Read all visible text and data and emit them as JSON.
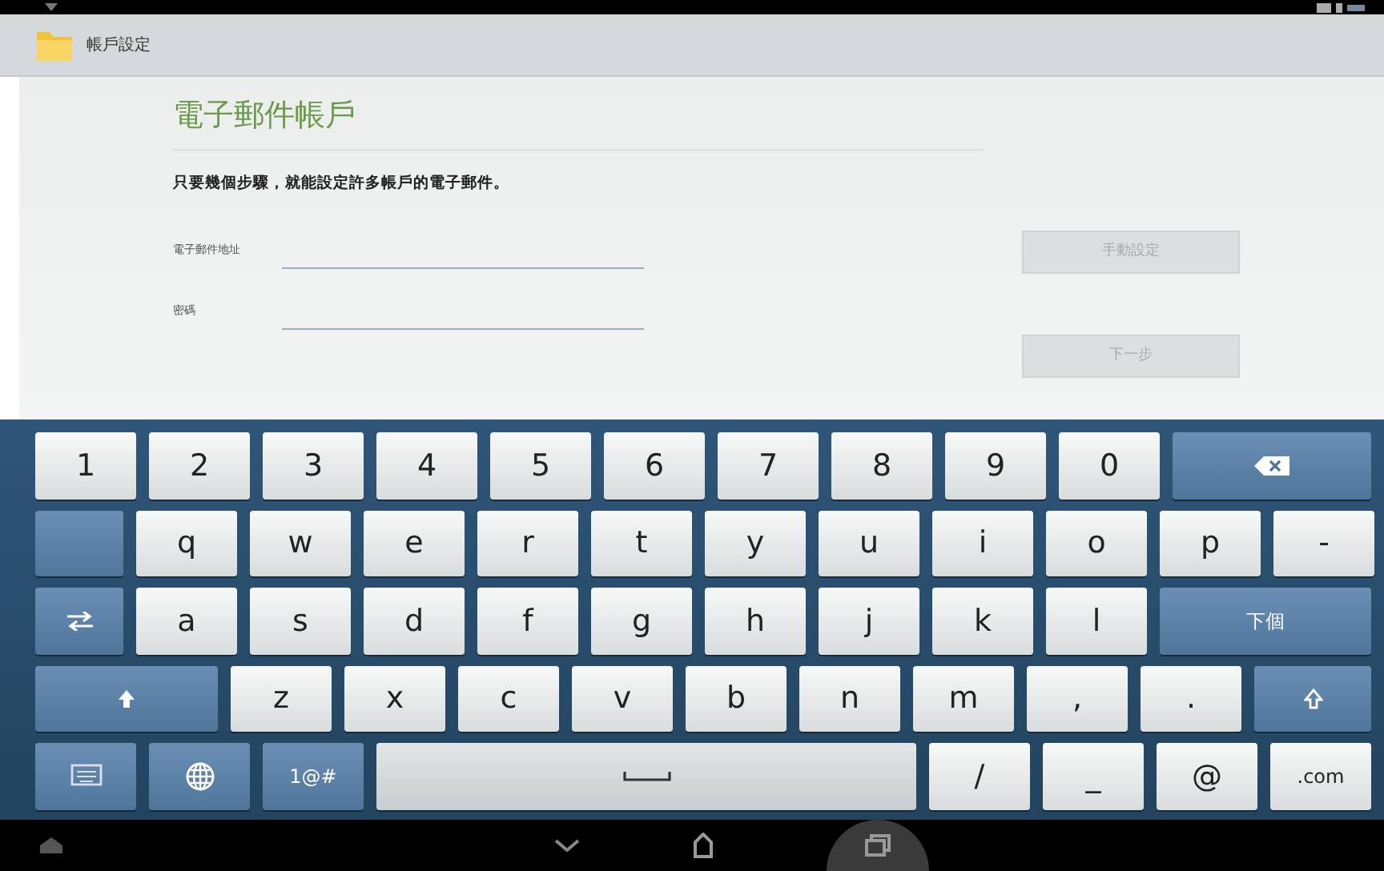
{
  "action_bar": {
    "title": "帳戶設定"
  },
  "content": {
    "heading": "電子郵件帳戶",
    "intro": "只要幾個步驟，就能設定許多帳戶的電子郵件。",
    "fields": [
      {
        "label": "電子郵件地址"
      },
      {
        "label": "密碼"
      }
    ],
    "buttons": [
      {
        "label": "手動設定",
        "disabled": true
      },
      {
        "label": "下一步",
        "disabled": true
      }
    ]
  },
  "keyboard": {
    "rows": [
      {
        "keys": [
          {
            "kind": "char",
            "label": "1"
          },
          {
            "kind": "char",
            "label": "2"
          },
          {
            "kind": "char",
            "label": "3"
          },
          {
            "kind": "char",
            "label": "4"
          },
          {
            "kind": "char",
            "label": "5"
          },
          {
            "kind": "char",
            "label": "6"
          },
          {
            "kind": "char",
            "label": "7"
          },
          {
            "kind": "char",
            "label": "8"
          },
          {
            "kind": "char",
            "label": "9"
          },
          {
            "kind": "char",
            "label": "0"
          },
          {
            "kind": "backspace"
          }
        ]
      },
      {
        "keys": [
          {
            "kind": "blank"
          },
          {
            "kind": "char",
            "label": "q"
          },
          {
            "kind": "char",
            "label": "w"
          },
          {
            "kind": "char",
            "label": "e"
          },
          {
            "kind": "char",
            "label": "r"
          },
          {
            "kind": "char",
            "label": "t"
          },
          {
            "kind": "char",
            "label": "y"
          },
          {
            "kind": "char",
            "label": "u"
          },
          {
            "kind": "char",
            "label": "i"
          },
          {
            "kind": "char",
            "label": "o"
          },
          {
            "kind": "char",
            "label": "p"
          },
          {
            "kind": "char",
            "label": "-"
          }
        ]
      },
      {
        "keys": [
          {
            "kind": "switch"
          },
          {
            "kind": "char",
            "label": "a"
          },
          {
            "kind": "char",
            "label": "s"
          },
          {
            "kind": "char",
            "label": "d"
          },
          {
            "kind": "char",
            "label": "f"
          },
          {
            "kind": "char",
            "label": "g"
          },
          {
            "kind": "char",
            "label": "h"
          },
          {
            "kind": "char",
            "label": "j"
          },
          {
            "kind": "char",
            "label": "k"
          },
          {
            "kind": "char",
            "label": "l"
          },
          {
            "kind": "next",
            "label": "下個"
          }
        ]
      },
      {
        "keys": [
          {
            "kind": "shift"
          },
          {
            "kind": "char",
            "label": "z"
          },
          {
            "kind": "char",
            "label": "x"
          },
          {
            "kind": "char",
            "label": "c"
          },
          {
            "kind": "char",
            "label": "v"
          },
          {
            "kind": "char",
            "label": "b"
          },
          {
            "kind": "char",
            "label": "n"
          },
          {
            "kind": "char",
            "label": "m"
          },
          {
            "kind": "char",
            "label": ","
          },
          {
            "kind": "char",
            "label": "."
          },
          {
            "kind": "shift2"
          }
        ]
      },
      {
        "keys": [
          {
            "kind": "settings"
          },
          {
            "kind": "globe"
          },
          {
            "kind": "sym",
            "label": "1@#"
          },
          {
            "kind": "space"
          },
          {
            "kind": "char",
            "label": "/"
          },
          {
            "kind": "char",
            "label": "_"
          },
          {
            "kind": "char",
            "label": "@"
          },
          {
            "kind": "char",
            "label": ".com"
          }
        ]
      }
    ]
  }
}
